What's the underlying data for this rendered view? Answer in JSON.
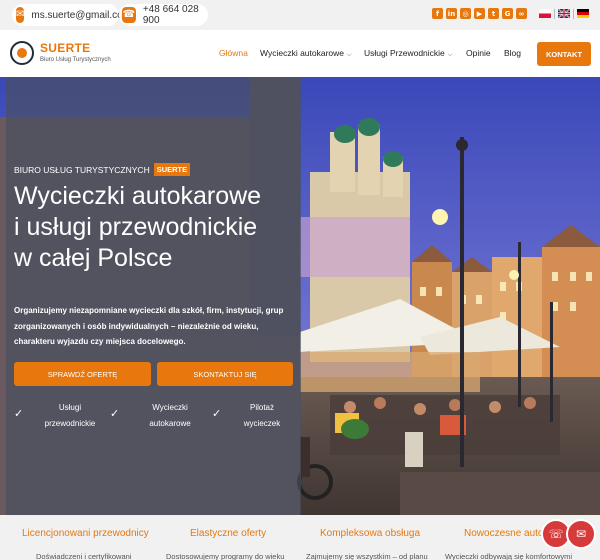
{
  "topbar": {
    "email": "ms.suerte@gmail.com",
    "phone": "+48 664 028 900",
    "email_icon": "envelope-icon",
    "phone_icon": "phone-icon",
    "social_icons": [
      "facebook-icon",
      "linkedin-icon",
      "instagram-icon",
      "youtube-icon",
      "twitter-icon",
      "google-icon",
      "tripadvisor-icon"
    ],
    "languages": [
      "pl",
      "en",
      "de"
    ]
  },
  "header": {
    "logo_name": "SUERTE",
    "logo_sub": "Biuro Usług Turystycznych",
    "nav": [
      {
        "label": "Główna",
        "active": true
      },
      {
        "label": "Wycieczki autokarowe",
        "dropdown": true
      },
      {
        "label": "Usługi Przewodnickie",
        "dropdown": true
      },
      {
        "label": "Opinie"
      },
      {
        "label": "Blog"
      }
    ],
    "cta": "KONTAKT"
  },
  "hero": {
    "kicker": "BIURO USŁUG TURYSTYCZNYCH",
    "kicker_brand": "SUERTE",
    "title_lines": [
      "Wycieczki autokarowe",
      "i usługi przewodnickie",
      "w całej Polsce"
    ],
    "description_lines": [
      "Organizujemy niezapomniane wycieczki dla szkół, firm, instytucji, grup",
      "zorganizowanych i osób indywidualnych – niezależnie od wieku,",
      "charakteru wyjazdu czy miejsca docelowego."
    ],
    "buttons": [
      "SPRAWDŹ OFERTĘ",
      "SKONTAKTUJ SIĘ"
    ],
    "features": [
      {
        "line1": "Usługi",
        "line2": "przewodnickie"
      },
      {
        "line1": "Wycieczki",
        "line2": "autokarowe"
      },
      {
        "line1": "Pilotaż",
        "line2": "wycieczek"
      }
    ]
  },
  "benefits": [
    {
      "title": "Licencjonowani przewodnicy",
      "text": "Doświadczeni i certyfikowani"
    },
    {
      "title": "Elastyczne oferty",
      "text": "Dostosowujemy programy do wieku"
    },
    {
      "title": "Kompleksowa obsługa",
      "text": "Zajmujemy się wszystkim – od planu"
    },
    {
      "title": "Nowoczesne auto",
      "text": "Wycieczki odbywają się komfortowymi"
    }
  ],
  "floating": {
    "call_icon": "phone-call-icon",
    "mail_icon": "mail-icon"
  }
}
